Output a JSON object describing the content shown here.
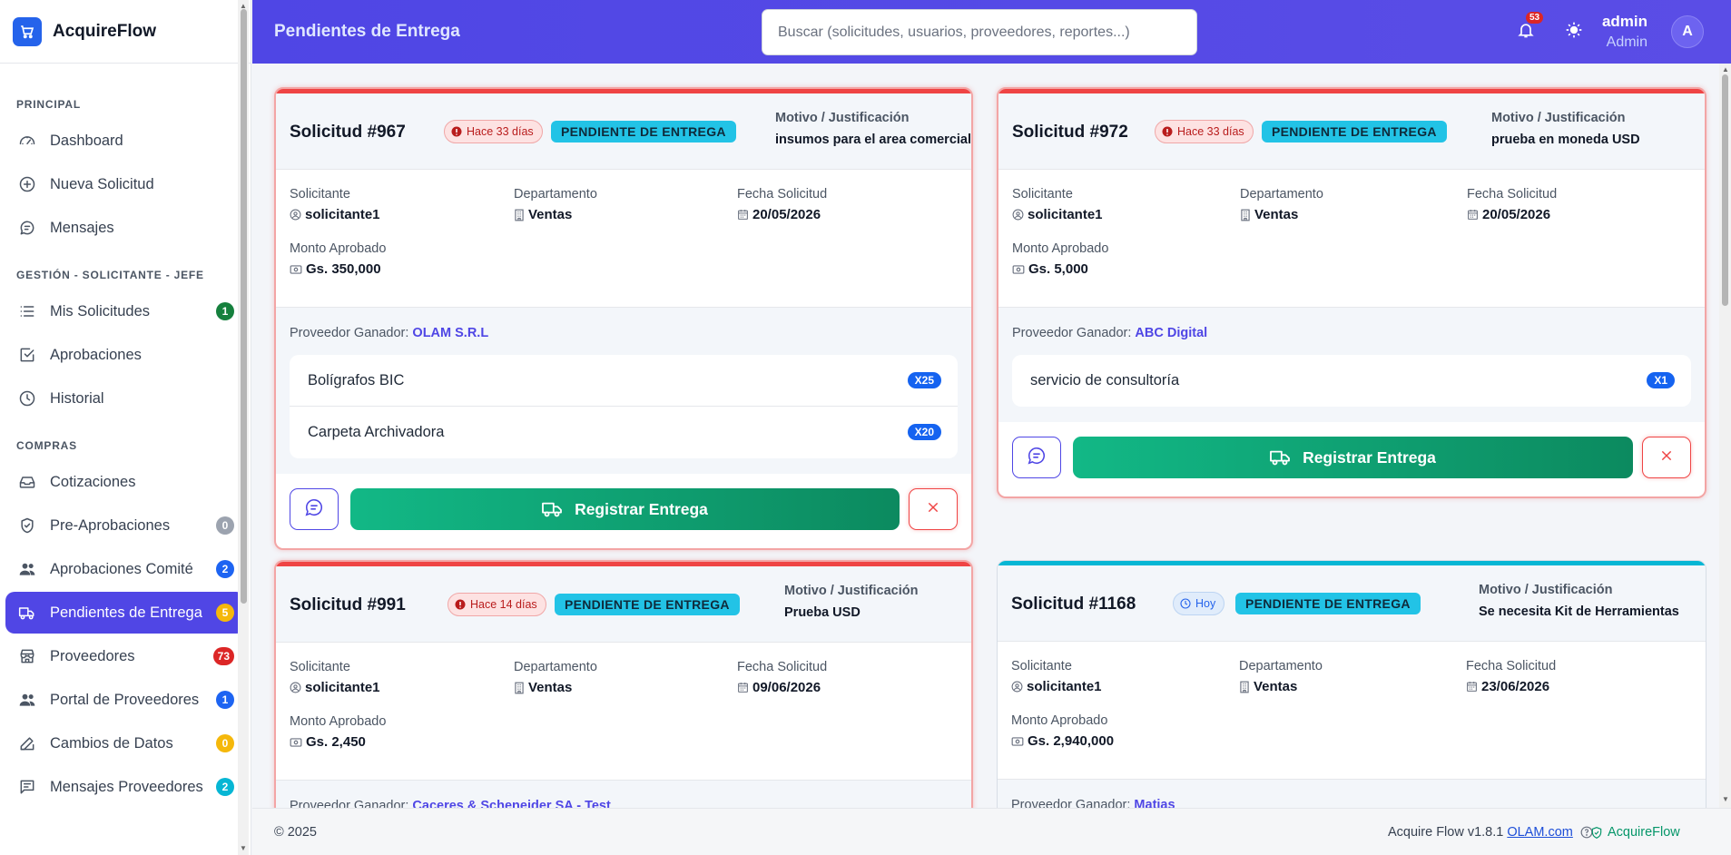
{
  "app": {
    "name": "AcquireFlow"
  },
  "colors": {
    "accent": "#4f46e5",
    "success": "#12b886",
    "danger": "#ef4444",
    "info": "#22c3e6"
  },
  "sidebar": {
    "sections": [
      {
        "title": "PRINCIPAL",
        "items": [
          {
            "label": "Dashboard",
            "icon": "gauge-icon"
          },
          {
            "label": "Nueva Solicitud",
            "icon": "plus-circle-icon"
          },
          {
            "label": "Mensajes",
            "icon": "chat-icon"
          }
        ]
      },
      {
        "title": "GESTIÓN - SOLICITANTE - JEFE",
        "items": [
          {
            "label": "Mis Solicitudes",
            "icon": "list-icon",
            "badge": "1",
            "badge_color": "#15803d"
          },
          {
            "label": "Aprobaciones",
            "icon": "check-square-icon"
          },
          {
            "label": "Historial",
            "icon": "clock-icon"
          }
        ]
      },
      {
        "title": "COMPRAS",
        "items": [
          {
            "label": "Cotizaciones",
            "icon": "inbox-icon"
          },
          {
            "label": "Pre-Aprobaciones",
            "icon": "shield-check-icon",
            "badge": "0",
            "badge_color": "#9ca3af"
          },
          {
            "label": "Aprobaciones Comité",
            "icon": "people-icon",
            "badge": "2",
            "badge_color": "#1d64f2"
          },
          {
            "label": "Pendientes de Entrega",
            "icon": "truck-icon",
            "badge": "5",
            "badge_color": "#f5b80b",
            "active": true
          },
          {
            "label": "Proveedores",
            "icon": "shop-icon",
            "badge": "73",
            "badge_color": "#dc2626"
          },
          {
            "label": "Portal de Proveedores",
            "icon": "people-icon",
            "badge": "1",
            "badge_color": "#1d64f2"
          },
          {
            "label": "Cambios de Datos",
            "icon": "edit-icon",
            "badge": "0",
            "badge_color": "#f5b80b"
          },
          {
            "label": "Mensajes Proveedores",
            "icon": "message-icon",
            "badge": "2",
            "badge_color": "#06b6d4"
          }
        ]
      }
    ]
  },
  "header": {
    "title": "Pendientes de Entrega",
    "search_placeholder": "Buscar (solicitudes, usuarios, proveedores, reportes...)",
    "notifications": "53",
    "user_name": "admin",
    "user_role": "Admin",
    "avatar_initial": "A"
  },
  "labels": {
    "motivo": "Motivo / Justificación",
    "solicitante": "Solicitante",
    "departamento": "Departamento",
    "fecha": "Fecha Solicitud",
    "monto": "Monto Aprobado",
    "proveedor": "Proveedor Ganador:",
    "registrar": "Registrar Entrega"
  },
  "cards": [
    {
      "title": "Solicitud #967",
      "age": "Hace 33 días",
      "status": "PENDIENTE DE ENTREGA",
      "motivo": "insumos para el area comercial",
      "solicitante": "solicitante1",
      "departamento": "Ventas",
      "fecha": "20/05/2026",
      "monto": "Gs. 350,000",
      "proveedor": "OLAM S.R.L",
      "items": [
        {
          "name": "Bolígrafos BIC",
          "qty": "X25"
        },
        {
          "name": "Carpeta Archivadora",
          "qty": "X20"
        }
      ]
    },
    {
      "title": "Solicitud #972",
      "age": "Hace 33 días",
      "status": "PENDIENTE DE ENTREGA",
      "motivo": "prueba en moneda USD",
      "solicitante": "solicitante1",
      "departamento": "Ventas",
      "fecha": "20/05/2026",
      "monto": "Gs. 5,000",
      "proveedor": "ABC Digital",
      "items": [
        {
          "name": "servicio de consultoría",
          "qty": "X1"
        }
      ]
    },
    {
      "title": "Solicitud #991",
      "age": "Hace 14 días",
      "status": "PENDIENTE DE ENTREGA",
      "motivo": "Prueba USD",
      "solicitante": "solicitante1",
      "departamento": "Ventas",
      "fecha": "09/06/2026",
      "monto": "Gs. 2,450",
      "proveedor": "Caceres & Scheneider SA - Test",
      "items": []
    },
    {
      "title": "Solicitud #1168",
      "age": "Hoy",
      "status": "PENDIENTE DE ENTREGA",
      "motivo": "Se necesita Kit de Herramientas",
      "solicitante": "solicitante1",
      "departamento": "Ventas",
      "fecha": "23/06/2026",
      "monto": "Gs. 2,940,000",
      "proveedor": "Matias",
      "items": []
    }
  ],
  "footer": {
    "copyright": "© 2025",
    "version": "Acquire Flow v1.8.1",
    "link": "OLAM.com",
    "brand": "AcquireFlow"
  }
}
